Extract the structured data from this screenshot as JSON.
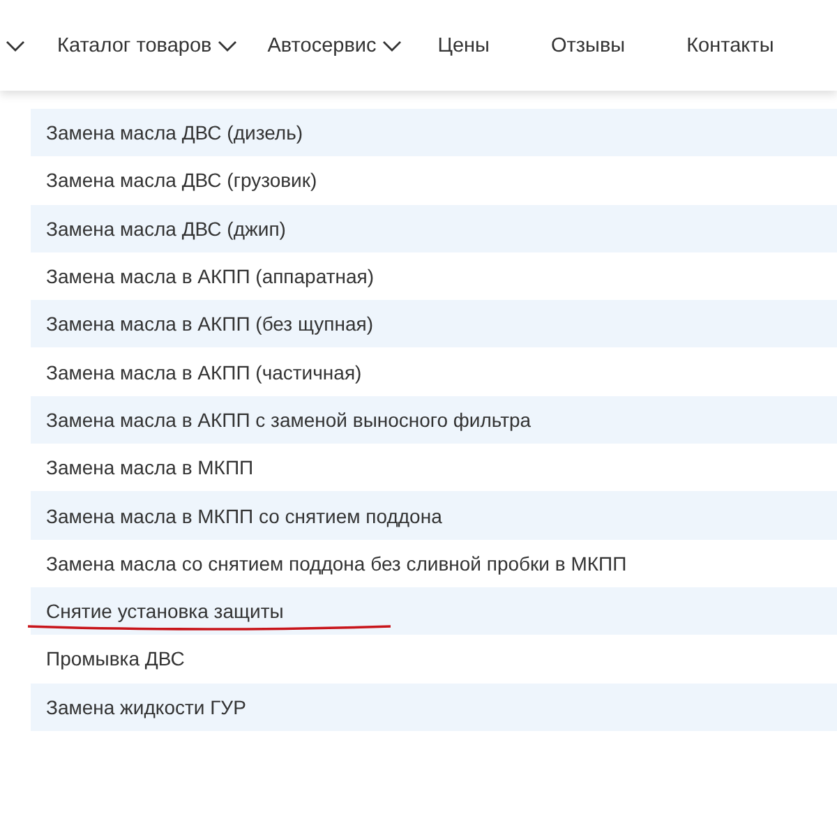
{
  "nav": {
    "items": [
      {
        "label": "Каталог товаров",
        "dropdown": true
      },
      {
        "label": "Автосервис",
        "dropdown": true
      },
      {
        "label": "Цены",
        "dropdown": false
      },
      {
        "label": "Отзывы",
        "dropdown": false
      },
      {
        "label": "Контакты",
        "dropdown": false
      }
    ]
  },
  "services": [
    {
      "name": "Замена масла ДВС (дизель)",
      "underlined": false
    },
    {
      "name": "Замена масла ДВС (грузовик)",
      "underlined": false
    },
    {
      "name": "Замена масла ДВС (джип)",
      "underlined": false
    },
    {
      "name": "Замена масла в АКПП (аппаратная)",
      "underlined": false
    },
    {
      "name": "Замена масла в АКПП (без щупная)",
      "underlined": false
    },
    {
      "name": "Замена масла в АКПП (частичная)",
      "underlined": false
    },
    {
      "name": "Замена масла в АКПП с заменой выносного фильтра",
      "underlined": false
    },
    {
      "name": "Замена масла в МКПП",
      "underlined": false
    },
    {
      "name": "Замена масла в МКПП со снятием поддона",
      "underlined": false
    },
    {
      "name": "Замена масла со снятием поддона без сливной пробки в МКПП",
      "underlined": false
    },
    {
      "name": "Снятие установка защиты",
      "underlined": true
    },
    {
      "name": "Промывка ДВС",
      "underlined": false
    },
    {
      "name": "Замена жидкости ГУР",
      "underlined": false
    }
  ]
}
